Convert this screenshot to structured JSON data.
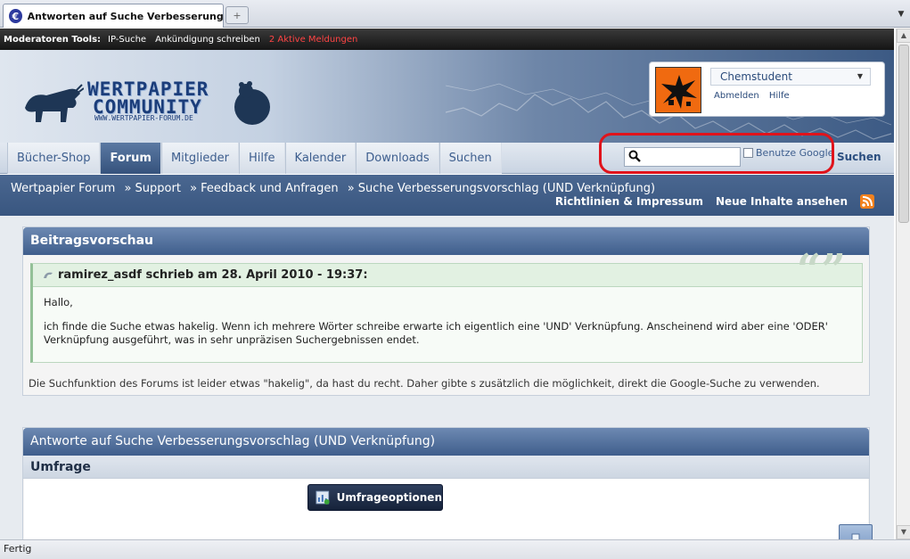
{
  "browser": {
    "tab_title": "Antworten auf Suche Verbesserungs...",
    "new_tab_symbol": "+",
    "status": "Fertig"
  },
  "modbar": {
    "label": "Moderatoren Tools:",
    "links": [
      "IP-Suche",
      "Ankündigung schreiben"
    ],
    "alert": "2 Aktive Meldungen",
    "alert_color": "#ff4444"
  },
  "header": {
    "logo_line1": "WERTPAPIER",
    "logo_line2": "COMMUNITY",
    "logo_url": "WWW.WERTPAPIER-FORUM.DE"
  },
  "user": {
    "name": "Chemstudent",
    "links": [
      "Abmelden",
      "Hilfe"
    ]
  },
  "nav": {
    "tabs": [
      "Bücher-Shop",
      "Forum",
      "Mitglieder",
      "Hilfe",
      "Kalender",
      "Downloads",
      "Suchen"
    ],
    "active": "Forum",
    "google_label": "Benutze Google",
    "search_button": "Suchen"
  },
  "breadcrumb": {
    "items": [
      "Wertpapier Forum",
      "» Support",
      "» Feedback und Anfragen",
      "» Suche Verbesserungsvorschlag (UND Verknüpfung)"
    ],
    "links": [
      "Richtlinien & Impressum",
      "Neue Inhalte ansehen"
    ]
  },
  "preview": {
    "title": "Beitragsvorschau",
    "quote_header": "ramirez_asdf schrieb am 28. April 2010 - 19:37:",
    "quote_greeting": "Hallo,",
    "quote_text": "ich finde die Suche etwas hakelig. Wenn ich mehrere Wörter schreibe erwarte ich eigentlich eine 'UND' Verknüpfung. Anscheinend wird aber eine 'ODER' Verknüpfung ausgeführt, was in sehr unpräzisen Suchergebnissen endet.",
    "reply_text": "Die Suchfunktion des Forums ist leider etwas \"hakelig\", da hast du recht. Daher gibte s zusätzlich die möglichkeit, direkt die Google-Suche zu verwenden."
  },
  "answer": {
    "title": "Antworte auf Suche Verbesserungsvorschlag (UND Verknüpfung)",
    "subtitle": "Umfrage",
    "poll_button": "Umfrageoptionen"
  },
  "colors": {
    "highlight_red": "#e0131b",
    "header_blue": "#3f5e8c",
    "nav_active": "#35527c"
  }
}
